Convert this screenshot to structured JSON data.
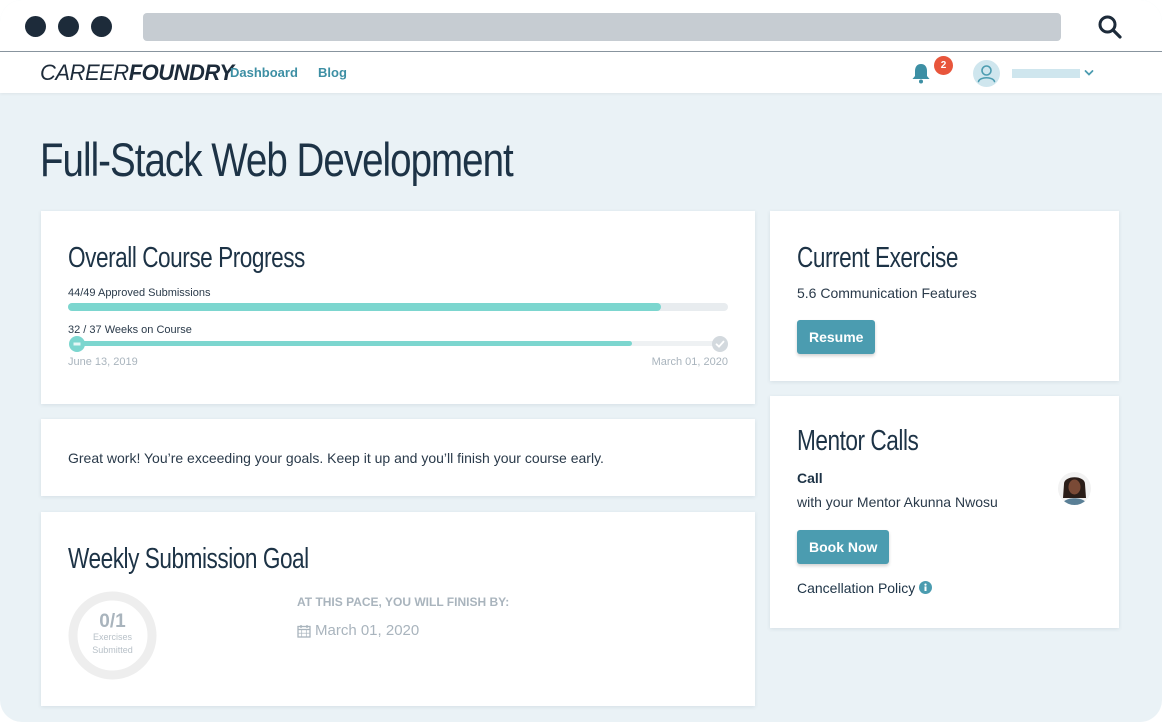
{
  "browser": {
    "search_icon": "search-icon"
  },
  "nav": {
    "logo_part1": "CAREER",
    "logo_part2": "FOUNDRY",
    "links": [
      {
        "label": "Dashboard"
      },
      {
        "label": "Blog"
      }
    ],
    "notification_count": "2",
    "accent_color": "#3d8fa4",
    "badge_color": "#e8553b"
  },
  "page": {
    "title": "Full-Stack Web Development"
  },
  "progress_card": {
    "title": "Overall Course Progress",
    "submissions_label": "44/49 Approved Submissions",
    "submissions_fraction": 0.898,
    "weeks_label": "32 / 37 Weeks on Course",
    "weeks_fraction": 0.865,
    "start_date": "June 13, 2019",
    "end_date": "March 01, 2020"
  },
  "message_card": {
    "text": "Great work! You’re exceeding your goals. Keep it up and you’ll finish your course early."
  },
  "weekly_card": {
    "title": "Weekly Submission Goal",
    "goal_value": "0/1",
    "goal_caption_1": "Exercises",
    "goal_caption_2": "Submitted",
    "goal_fraction": 0,
    "finish_heading": "AT THIS PACE, YOU WILL FINISH BY:",
    "finish_date": "March 01, 2020"
  },
  "current_exercise": {
    "title": "Current Exercise",
    "exercise": "5.6 Communication Features",
    "button_label": "Resume"
  },
  "mentor_calls": {
    "title": "Mentor Calls",
    "call_label": "Call",
    "mentor_text": "with your Mentor Akunna Nwosu",
    "button_label": "Book Now",
    "policy_label": "Cancellation Policy"
  },
  "colors": {
    "progress_fill": "#7cd6cf",
    "button": "#4b9cb0",
    "background": "#eaf2f6"
  }
}
